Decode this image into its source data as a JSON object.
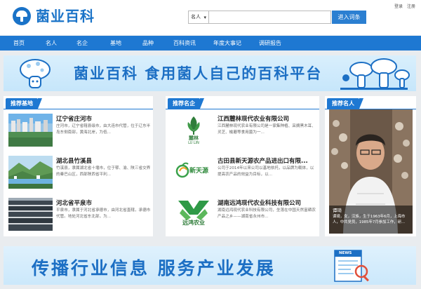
{
  "header": {
    "logo_text": "菌业百科",
    "search": {
      "select_value": "名人",
      "input_value": "",
      "button_label": "进入词条"
    },
    "links": {
      "login": "登录",
      "register": "注册"
    }
  },
  "nav": {
    "items": [
      "首页",
      "名人",
      "名企",
      "基地",
      "品种",
      "百科资讯",
      "年度大事记",
      "调研报告"
    ]
  },
  "banner_top": {
    "text": "菌业百科 食用菌人自己的百科平台"
  },
  "bases": {
    "title": "推荐基地",
    "items": [
      {
        "name": "辽宁省庄河市",
        "desc": "庄河市，辽宁省辖县级市，由大连市代管，位于辽东半岛东侧南部，黄海北岸，为低..."
      },
      {
        "name": "湖北县竹溪县",
        "desc": "竹溪县，隶属湖北省十堰市，位于鄂、渝、陕三省交界的秦巴山区，西部陕西省平利..."
      },
      {
        "name": "河北省平泉市",
        "desc": "平泉市，隶属于河北省承德市，由河北省直辖，承德市代管。地处河北省东北部，为..."
      }
    ]
  },
  "companies": {
    "title": "推荐名企",
    "items": [
      {
        "name": "江西麓林现代农业有限公司",
        "desc": "江西麓林现代农业有限公司是一家集种植、采摘黑木耳、灵芝、榆蘑等食用菌为一...",
        "logo": "麓林",
        "logo_sub": "LU LIN"
      },
      {
        "name": "古田县新天源农产品进出口有限...",
        "desc": "公司于2014年以来公司以基地依托，以品牌为载体，以提高农产品的效益为目标，以...",
        "logo": "新天源"
      },
      {
        "name": "湖南远鸿现代农业科技有限公司",
        "desc": "湖南远鸿现代农业科技有限公司，坐落在中国天然富硒农产品之乡——湖南省永州市...",
        "logo": "远鸿农业"
      }
    ]
  },
  "person": {
    "title": "推荐名人",
    "name": "谭琦",
    "bio": "谭琦，女，汉族，生于1963年6月，上海市人，中共党员，1985年7月参加工作，研..."
  },
  "banner_bottom": {
    "text": "传播行业信息 服务产业发展",
    "badge": "NEWS"
  },
  "colors": {
    "primary": "#1e78d2",
    "logo_blue": "#1a73c8",
    "page_bg": "#e9ecef"
  }
}
